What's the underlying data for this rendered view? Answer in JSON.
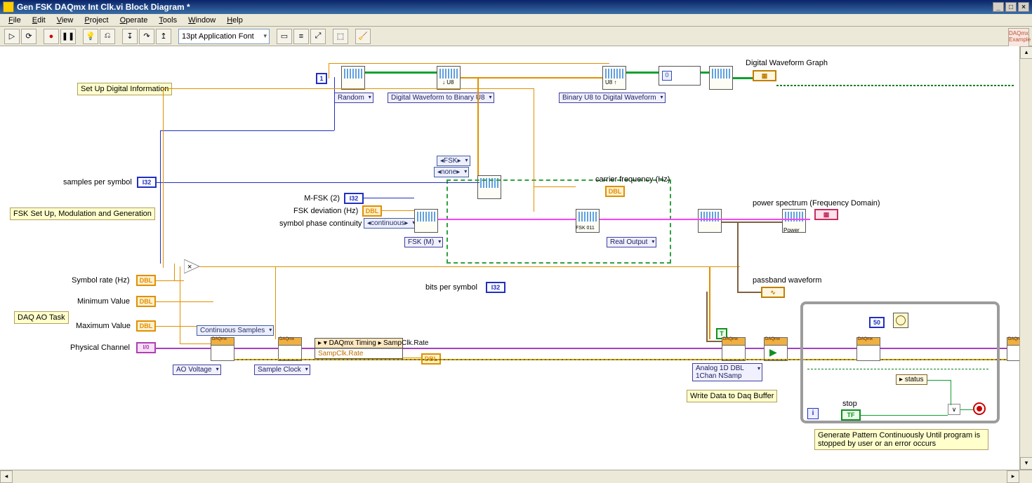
{
  "window": {
    "title": "Gen FSK DAQmx Int Clk.vi Block Diagram *"
  },
  "menu": {
    "file": "File",
    "edit": "Edit",
    "view": "View",
    "project": "Project",
    "operate": "Operate",
    "tools": "Tools",
    "window": "Window",
    "help": "Help"
  },
  "toolbar": {
    "font": "13pt Application Font",
    "help": "?",
    "palette": "DAQmx\nExample"
  },
  "comments": {
    "setup_digital": "Set Up Digital Information",
    "fsk_setup": "FSK Set Up, Modulation and Generation",
    "daq_task": "DAQ AO Task",
    "write_buffer": "Write Data to Daq Buffer",
    "loop_note": "Generate Pattern Continuously Until program is stopped by user or an error occurs"
  },
  "labels": {
    "samples_per_symbol": "samples per symbol",
    "symbol_rate": "Symbol rate (Hz)",
    "minimum_value": "Minimum Value",
    "maximum_value": "Maximum Value",
    "physical_channel": "Physical Channel",
    "m_fsk": "M-FSK (2)",
    "fsk_dev": "FSK deviation (Hz)",
    "phase_cont": "symbol phase continuity",
    "bits_per_symbol": "bits per symbol",
    "carrier_freq": "carrier frequency (Hz)",
    "power_spectrum": "power spectrum (Frequency Domain)",
    "passband": "passband waveform",
    "digital_graph": "Digital Waveform Graph",
    "stop": "stop",
    "status": "status",
    "sampclk_rate_out": "SampClk.Rate",
    "wait_ms": "50"
  },
  "poly": {
    "random": "Random",
    "dw2bu8": "Digital Waveform to Binary U8",
    "bu82dw": "Binary U8 to Digital Waveform",
    "fsk_m": "FSK (M)",
    "real_output": "Real Output",
    "ao_voltage": "AO Voltage",
    "sample_clock": "Sample Clock",
    "cont_samples": "Continuous Samples",
    "analog_write": "Analog 1D DBL 1Chan NSamp"
  },
  "rings": {
    "fsk": "FSK",
    "none": "none",
    "continuous": "continuous"
  },
  "propnode": {
    "hdr": "DAQmx Timing",
    "row": "SampClk.Rate"
  },
  "power_node": "Power",
  "terms": {
    "i32": "I32",
    "dbl": "DBL",
    "io": "I/0",
    "tf": "TF"
  }
}
